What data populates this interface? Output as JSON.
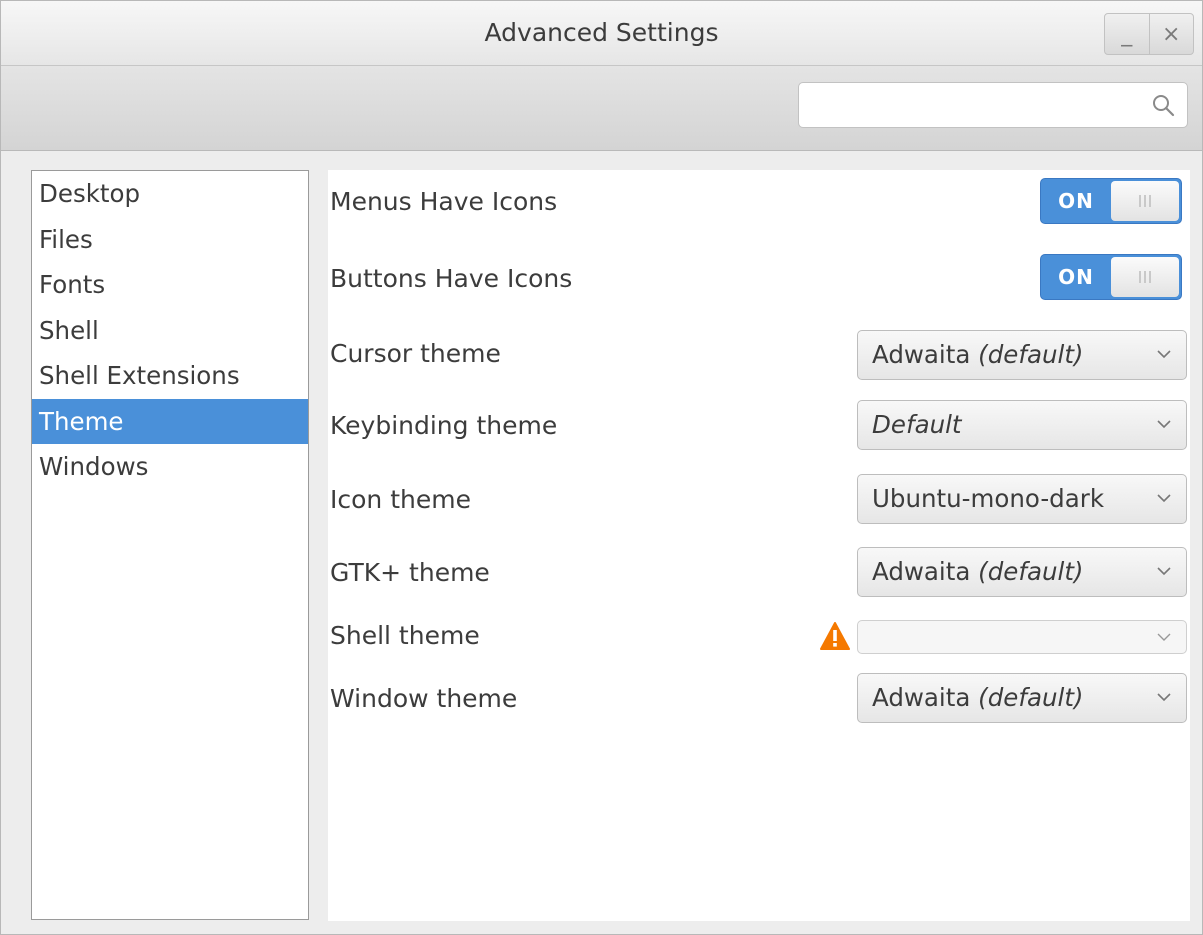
{
  "window": {
    "title": "Advanced Settings",
    "minimize_label": "_",
    "close_label": "×"
  },
  "search": {
    "value": "",
    "placeholder": ""
  },
  "sidebar": {
    "items": [
      {
        "label": "Desktop"
      },
      {
        "label": "Files"
      },
      {
        "label": "Fonts"
      },
      {
        "label": "Shell"
      },
      {
        "label": "Shell Extensions"
      },
      {
        "label": "Theme",
        "selected": true
      },
      {
        "label": "Windows"
      }
    ]
  },
  "settings": {
    "menus_have_icons": {
      "label": "Menus Have Icons",
      "state": "ON"
    },
    "buttons_have_icons": {
      "label": "Buttons Have Icons",
      "state": "ON"
    },
    "cursor_theme": {
      "label": "Cursor theme",
      "value": "Adwaita",
      "suffix": "(default)"
    },
    "keybinding_theme": {
      "label": "Keybinding theme",
      "value": "",
      "suffix": "Default"
    },
    "icon_theme": {
      "label": "Icon theme",
      "value": "Ubuntu-mono-dark",
      "suffix": ""
    },
    "gtk_theme": {
      "label": "GTK+ theme",
      "value": "Adwaita",
      "suffix": "(default)"
    },
    "shell_theme": {
      "label": "Shell theme",
      "value": "",
      "suffix": "",
      "warning_icon": "warning-icon"
    },
    "window_theme": {
      "label": "Window theme",
      "value": "Adwaita",
      "suffix": "(default)"
    }
  },
  "colors": {
    "accent": "#4a90d9",
    "warning": "#f57900"
  }
}
